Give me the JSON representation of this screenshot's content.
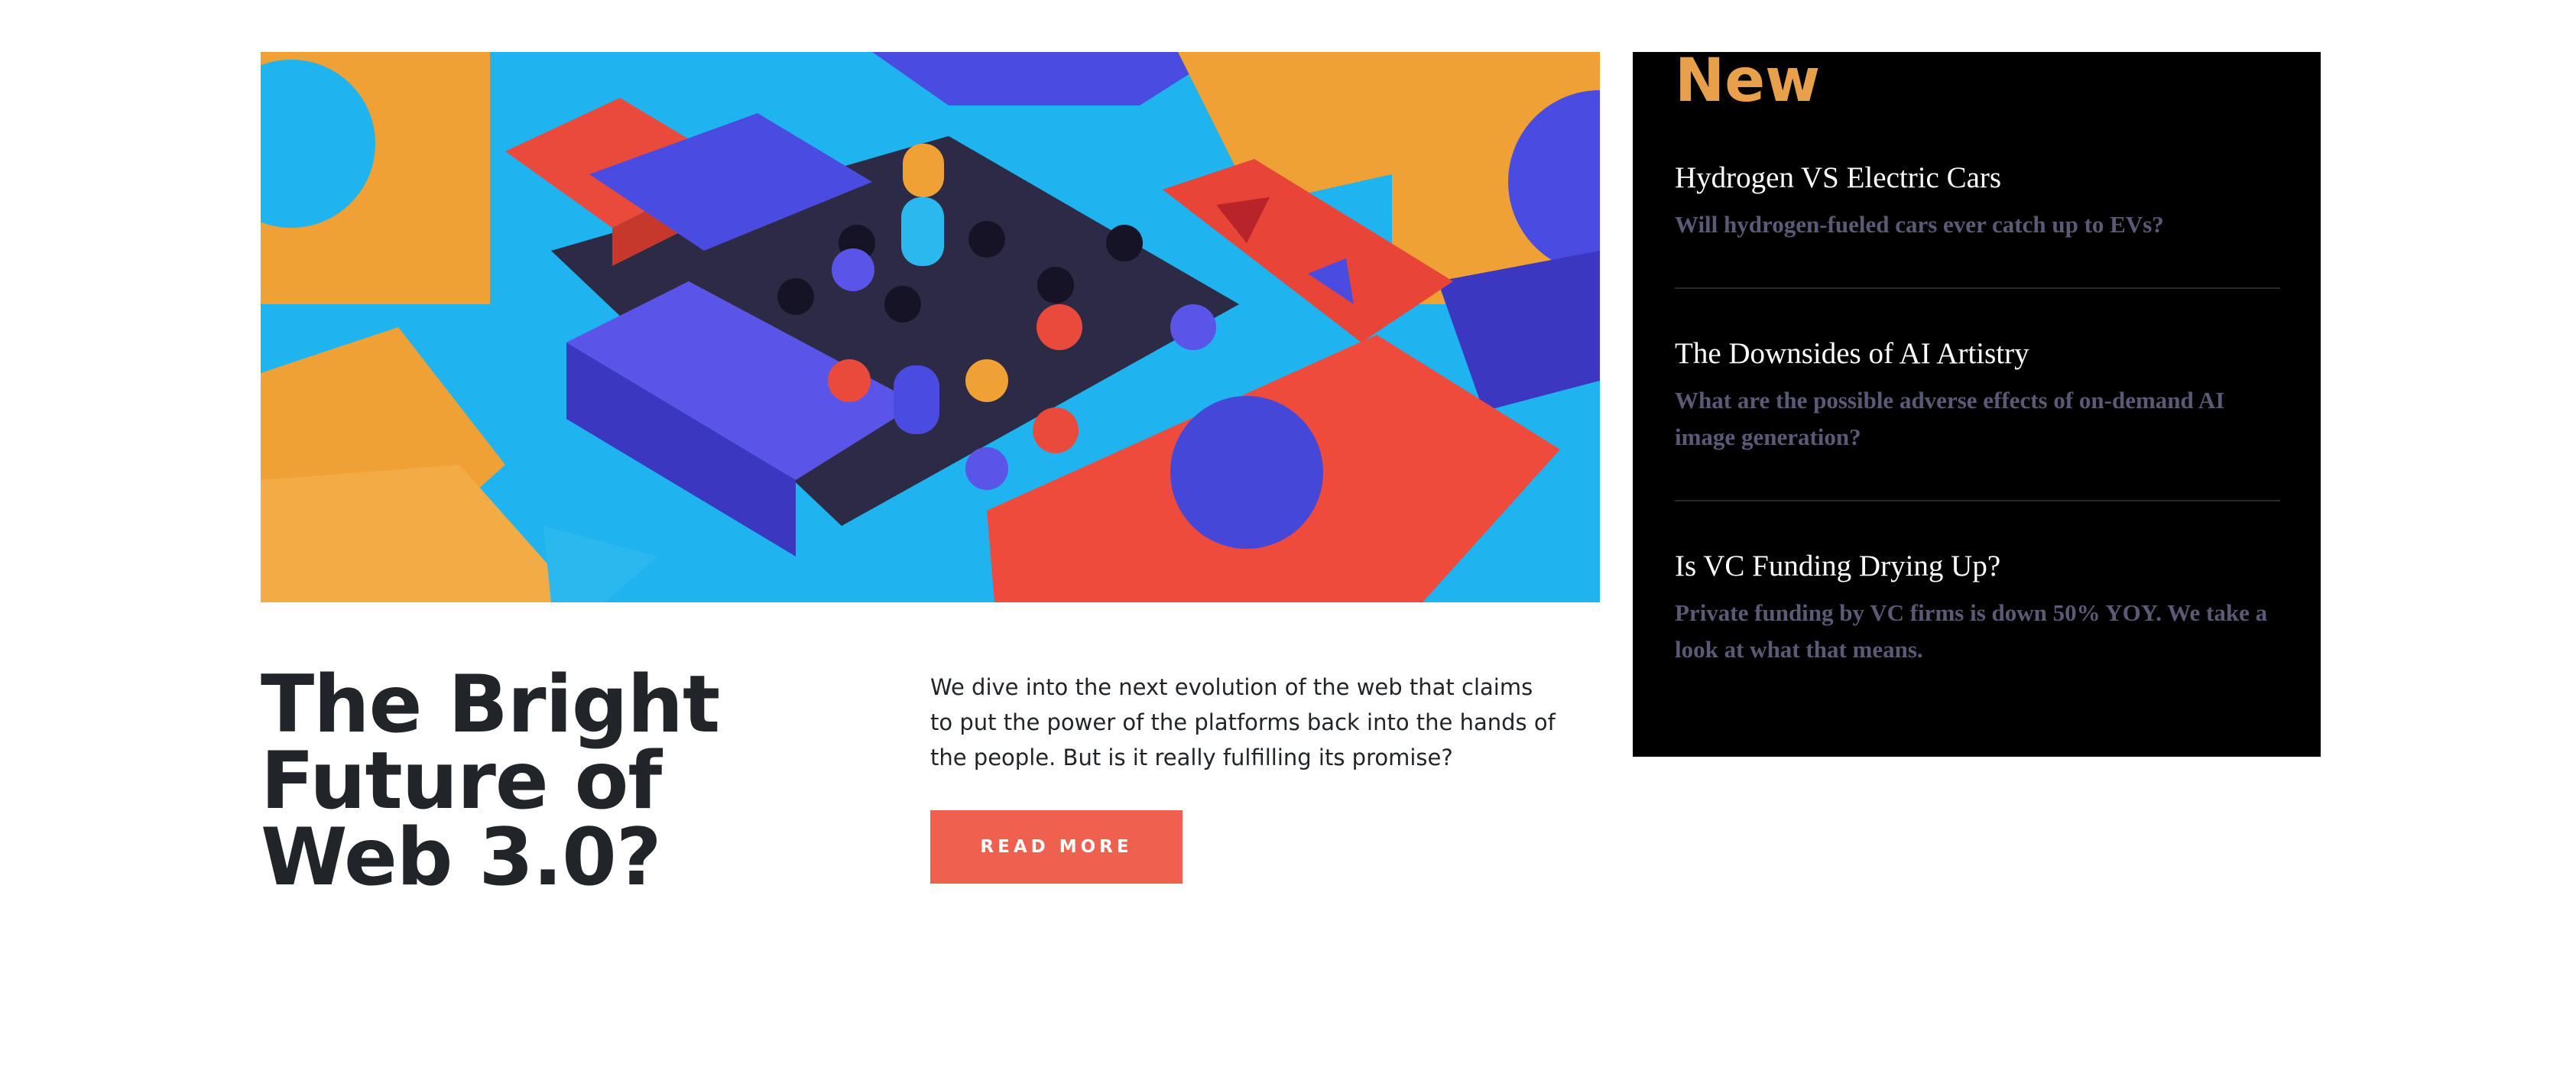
{
  "colors": {
    "accent": "#e8a14a",
    "button": "#f0604f",
    "panel_bg": "#000000",
    "muted_text": "#5a5a76",
    "title_text": "#212529"
  },
  "feature": {
    "title": "The Bright Future of Web 3.0?",
    "intro": "We dive into the next evolution of the web that claims to put the power of the platforms back into the hands of the people. But is it really fulfilling its promise?",
    "read_more_label": "READ MORE"
  },
  "sidebar": {
    "heading": "New",
    "items": [
      {
        "title": "Hydrogen VS Electric Cars",
        "description": "Will hydrogen-fueled cars ever catch up to EVs?"
      },
      {
        "title": "The Downsides of AI Artistry",
        "description": "What are the possible adverse effects of on-demand AI image generation?"
      },
      {
        "title": "Is VC Funding Drying Up?",
        "description": "Private funding by VC firms is down 50% YOY. We take a look at what that means."
      }
    ]
  }
}
